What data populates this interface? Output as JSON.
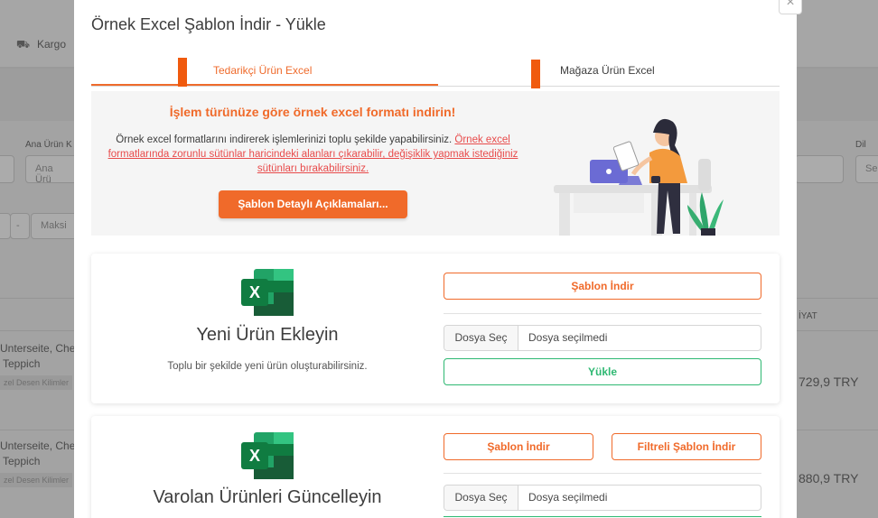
{
  "background": {
    "nav_item": "Kargo",
    "filter_label_1": "Ana Ürün K",
    "filter_input_1": "Ana Ürü",
    "filter_label_2": "Dil",
    "filter_input_2": "Se",
    "range_minus": "-",
    "range_max": "Maksi",
    "column_header": "İYAT",
    "rows": [
      {
        "name_line1": "Unterseite, Che",
        "name_line2": "Teppich",
        "tag": "zel Desen Kilimler",
        "price": "729,9 TRY"
      },
      {
        "name_line1": "Unterseite, Che",
        "name_line2": "Teppich",
        "tag": "zel Desen Kilimler",
        "price": "880,9 TRY"
      }
    ]
  },
  "modal": {
    "title": "Örnek Excel Şablon İndir - Yükle",
    "close_label": "×",
    "tabs": [
      {
        "label": "Tedarikçi Ürün Excel",
        "active": true
      },
      {
        "label": "Mağaza Ürün Excel",
        "active": false
      }
    ],
    "info": {
      "heading": "İşlem türünüze göre örnek excel formatı indirin!",
      "text": "Örnek excel formatlarını indirerek işlemlerinizi toplu şekilde yapabilirsiniz.",
      "link_text": "Örnek excel formatlarında zorunlu sütünlar haricindeki alanları çıkarabilir, değişiklik yapmak istediğiniz sütünları bırakabilirsiniz.",
      "button": "Şablon Detaylı Açıklamaları..."
    },
    "cards": [
      {
        "icon": "excel-icon",
        "title": "Yeni Ürün Ekleyin",
        "subtitle": "Toplu bir şekilde yeni ürün oluşturabilirsiniz.",
        "download_button": "Şablon İndir",
        "file_button": "Dosya Seç",
        "file_status": "Dosya seçilmedi",
        "upload_button": "Yükle"
      },
      {
        "icon": "excel-icon",
        "title": "Varolan Ürünleri Güncelleyin",
        "download_button": "Şablon İndir",
        "filtered_download_button": "Filtreli Şablon İndir",
        "file_button": "Dosya Seç",
        "file_status": "Dosya seçilmedi"
      }
    ]
  },
  "colors": {
    "accent_orange": "#f06a2a",
    "success_green": "#2eb872",
    "excel_green": "#1e7145"
  }
}
